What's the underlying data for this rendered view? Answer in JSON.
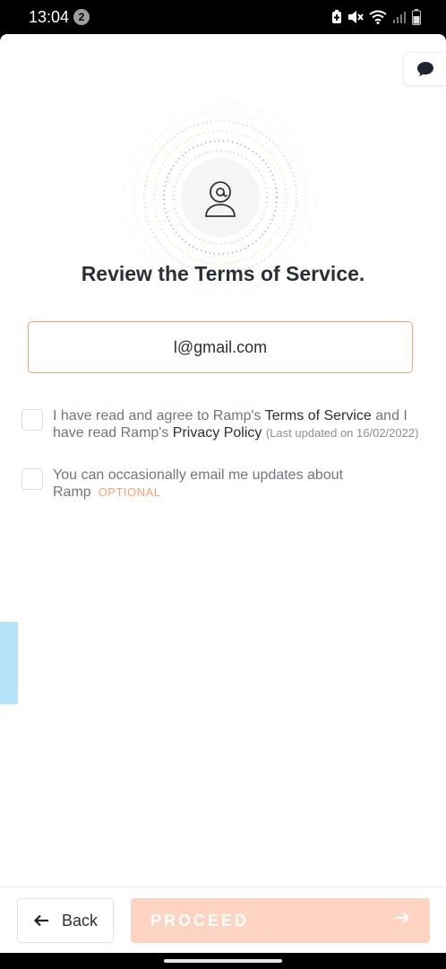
{
  "status_bar": {
    "time": "13:04",
    "notification_count": "2",
    "icons": [
      "battery-saver-icon",
      "mute-icon",
      "wifi-icon",
      "signal-icon",
      "battery-icon"
    ]
  },
  "header": {
    "chat_icon": "chat-bubble-icon"
  },
  "hero": {
    "icon": "user-at-icon",
    "colors": [
      "#f5c542",
      "#8bc34a",
      "#4caf50",
      "#f0a272"
    ]
  },
  "page": {
    "title": "Review the Terms of Service."
  },
  "email": {
    "value": "l@gmail.com",
    "accent": "#f0a272"
  },
  "terms": {
    "prefix": "I have read and agree to Ramp's ",
    "tos_link": "Terms of Service",
    "middle": " and I have read Ramp's ",
    "privacy_link": "Privacy Policy",
    "updated_note": "(Last updated on 16/02/2022)"
  },
  "marketing": {
    "text": "You can occasionally email me updates about Ramp",
    "optional_label": "OPTIONAL"
  },
  "footer": {
    "back_label": "Back",
    "proceed_label": "PROCEED",
    "proceed_color": "#fdd3c2"
  }
}
